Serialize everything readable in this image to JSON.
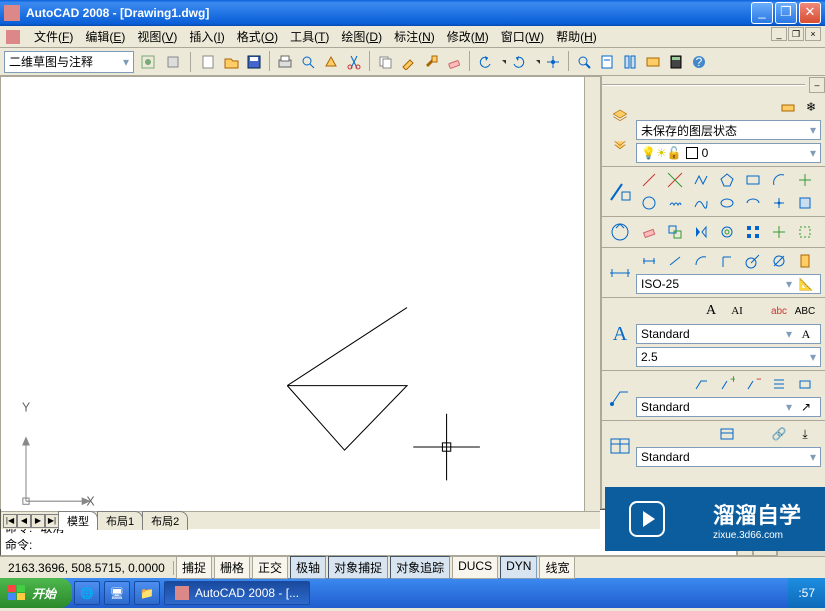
{
  "titlebar": {
    "text": "AutoCAD 2008 - [Drawing1.dwg]"
  },
  "menus": [
    {
      "label": "文件",
      "key": "F"
    },
    {
      "label": "编辑",
      "key": "E"
    },
    {
      "label": "视图",
      "key": "V"
    },
    {
      "label": "插入",
      "key": "I"
    },
    {
      "label": "格式",
      "key": "O"
    },
    {
      "label": "工具",
      "key": "T"
    },
    {
      "label": "绘图",
      "key": "D"
    },
    {
      "label": "标注",
      "key": "N"
    },
    {
      "label": "修改",
      "key": "M"
    },
    {
      "label": "窗口",
      "key": "W"
    },
    {
      "label": "帮助",
      "key": "H"
    }
  ],
  "workspace_selector": "二维草图与注释",
  "toolbar_icons": [
    "new",
    "open",
    "save",
    "plot",
    "plot-preview",
    "publish",
    "cut",
    "copy",
    "match",
    "paint",
    "eraser",
    "undo",
    "undo-dd",
    "redo",
    "redo-dd",
    "pan",
    "zoom",
    "sheetset",
    "tool-palette",
    "markup",
    "calc",
    "help"
  ],
  "tabs": {
    "nav": [
      "|◀",
      "◀",
      "▶",
      "▶|"
    ],
    "items": [
      {
        "label": "模型",
        "active": true
      },
      {
        "label": "布局1",
        "active": false
      },
      {
        "label": "布局2",
        "active": false
      }
    ]
  },
  "ucs_labels": {
    "x": "X",
    "y": "Y"
  },
  "panels": {
    "layers": {
      "state_selector": "未保存的图层状态",
      "layer_selector": "0",
      "side_icons": [
        "layers-stack",
        "filter"
      ]
    },
    "draw": {
      "row1": [
        "line",
        "xline",
        "pline",
        "polygon",
        "rect",
        "arc",
        "move"
      ],
      "row2": [
        "circle",
        "revcloud",
        "spline",
        "ellipse",
        "ellipse-arc",
        "point",
        "block"
      ]
    },
    "modify": {
      "row": [
        "erase",
        "copy",
        "mirror",
        "offset",
        "array",
        "move",
        "addsel"
      ]
    },
    "dim": {
      "row": [
        "linear",
        "aligned",
        "arc-len",
        "ordinate",
        "radius",
        "diameter",
        "tool"
      ],
      "style_selector": "ISO-25"
    },
    "text": {
      "icons": [
        "mtext",
        "text"
      ],
      "extra_icons": [
        "spell",
        "find"
      ],
      "style_selector": "Standard",
      "height": "2.5"
    },
    "leader": {
      "row": [
        "mleader",
        "add",
        "remove",
        "align",
        "collect"
      ],
      "style_selector": "Standard"
    },
    "table": {
      "icons": [
        "table"
      ],
      "extra": [
        "link",
        "extract"
      ],
      "style_selector": "Standard"
    }
  },
  "command": {
    "lines": [
      "命令: *取消*",
      "命令:"
    ]
  },
  "status": {
    "coords": "2163.3696, 508.5715, 0.0000",
    "toggles": [
      {
        "label": "捕捉",
        "on": false
      },
      {
        "label": "栅格",
        "on": false
      },
      {
        "label": "正交",
        "on": false
      },
      {
        "label": "极轴",
        "on": true
      },
      {
        "label": "对象捕捉",
        "on": true
      },
      {
        "label": "对象追踪",
        "on": true
      },
      {
        "label": "DUCS",
        "on": false
      },
      {
        "label": "DYN",
        "on": true
      },
      {
        "label": "线宽",
        "on": false
      }
    ]
  },
  "taskbar": {
    "start": "开始",
    "items": [
      {
        "label": "",
        "icon": "ie"
      },
      {
        "label": "",
        "icon": "folder"
      },
      {
        "label": "AutoCAD 2008 - [...",
        "active": true
      }
    ],
    "tray_time": ":57"
  },
  "watermark": {
    "title": "溜溜自学",
    "sub": "zixue.3d66.com"
  }
}
